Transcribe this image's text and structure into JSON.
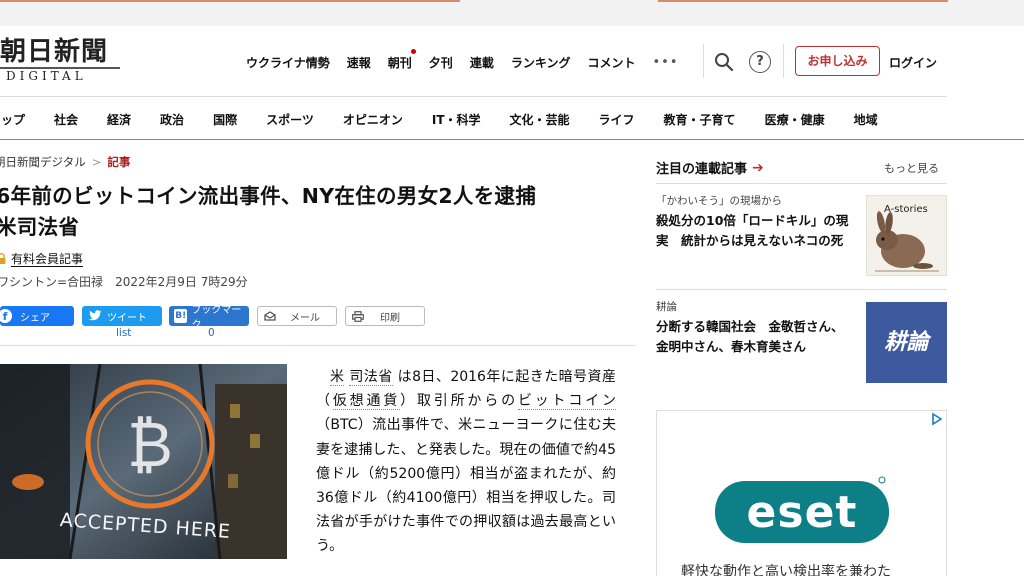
{
  "logo": {
    "ja": "朝日新聞",
    "en": "DIGITAL"
  },
  "topnav": {
    "items": [
      "ウクライナ情勢",
      "速報",
      "朝刊",
      "夕刊",
      "連載",
      "ランキング",
      "コメント"
    ],
    "more": "•••",
    "subscribe": "お申し込み",
    "login": "ログイン"
  },
  "categories": [
    "トップ",
    "社会",
    "経済",
    "政治",
    "国際",
    "スポーツ",
    "オピニオン",
    "IT・科学",
    "文化・芸能",
    "ライフ",
    "教育・子育て",
    "医療・健康",
    "地域"
  ],
  "breadcrumb": {
    "home": "朝日新聞デジタル",
    "sep": ">",
    "current": "記事"
  },
  "article": {
    "headline_line1": "6年前のビットコイン流出事件、NY在住の男女2人を逮捕",
    "headline_line2": "米司法省",
    "member_label": "有料会員記事",
    "byline": "ワシントン=合田禄",
    "date": "2022年2月9日",
    "time": "7時29分",
    "body": {
      "kw1": "米",
      "kw2": "司法省",
      "t1": "は8日、2016年に起きた暗号資産（",
      "kw3": "仮想通貨",
      "t2": "）取引所からの",
      "kw4": "ビットコイン",
      "t3": "（BTC）流出事件で、米ニューヨークに住む夫妻を逮捕した、と発表した。現在の価値で約45億ドル（約5200億円）相当が盗まれたが、約36億ドル（約4100億円）相当を押収した。司法省が手がけた事件での押収額は過去最高という。"
    },
    "image_caption_text": "ACCEPTED HERE"
  },
  "share": {
    "facebook": "シェア",
    "twitter": "ツイート",
    "hatena": "ブックマーク",
    "mail": "メール",
    "print": "印刷",
    "twitter_count": "list",
    "hatena_count": "0"
  },
  "sidebar": {
    "heading": "注目の連載記事",
    "more": "もっと見る",
    "cards": [
      {
        "category": "「かわいそう」の現場から",
        "title": "殺処分の10倍「ロードキル」の現実　統計からは見えないネコの死",
        "thumb_text": "A-stories"
      },
      {
        "category": "耕論",
        "title": "分断する韓国社会　金敬哲さん、金明中さん、春木育美さん",
        "thumb_text": "耕論"
      }
    ]
  },
  "ad": {
    "brand": "eset",
    "tagline": "軽快な動作と高い検出率を兼わた"
  },
  "colors": {
    "accent_red": "#c03030",
    "facebook": "#1877f2",
    "twitter": "#1d9bf0",
    "hatena": "#2d76d0",
    "eset_teal": "#0d7f86"
  }
}
